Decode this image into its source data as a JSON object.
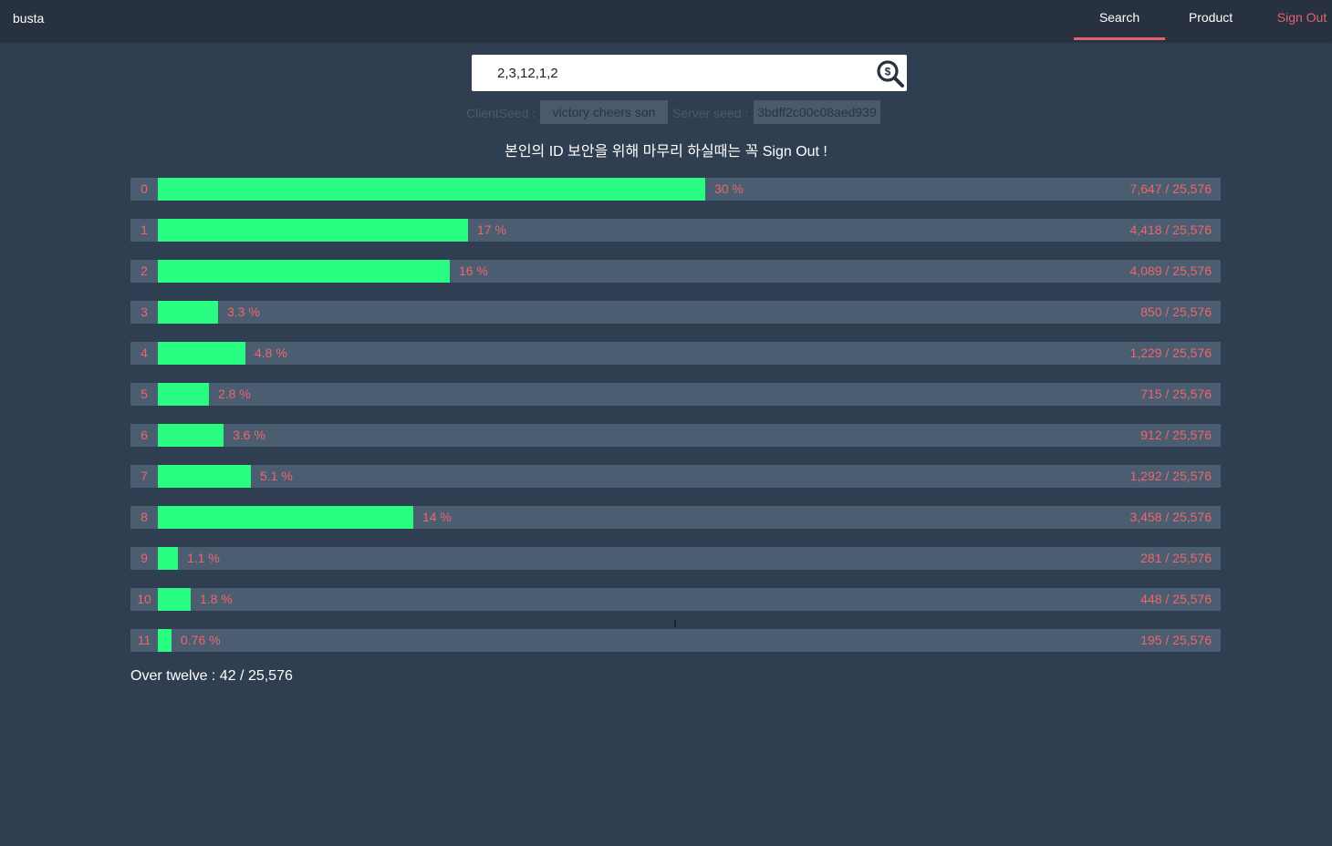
{
  "nav": {
    "brand": "busta",
    "search": "Search",
    "product": "Product",
    "signout": "Sign Out",
    "accent_color": "#e2636f"
  },
  "search": {
    "value": "2,3,12,1,2",
    "icon": "dollar-magnifier-icon"
  },
  "seeds": {
    "client_label": "ClientSeed :",
    "client_value": "victory cheers son",
    "server_label": "Server seed :",
    "server_value": "3bdff2c00c08aed939"
  },
  "notice": "본인의 ID 보안을 위해 마무리 하실때는 꼭 Sign Out !",
  "results": {
    "bar_color": "#28fd82",
    "text_color": "#f0646a",
    "rows": [
      {
        "index": "0",
        "fraction": 0.3,
        "percent": "30 %",
        "count": "7,647 / 25,576"
      },
      {
        "index": "1",
        "fraction": 0.17,
        "percent": "17 %",
        "count": "4,418 / 25,576"
      },
      {
        "index": "2",
        "fraction": 0.16,
        "percent": "16 %",
        "count": "4,089 / 25,576"
      },
      {
        "index": "3",
        "fraction": 0.033,
        "percent": "3.3 %",
        "count": "850 / 25,576"
      },
      {
        "index": "4",
        "fraction": 0.048,
        "percent": "4.8 %",
        "count": "1,229 / 25,576"
      },
      {
        "index": "5",
        "fraction": 0.028,
        "percent": "2.8 %",
        "count": "715 / 25,576"
      },
      {
        "index": "6",
        "fraction": 0.036,
        "percent": "3.6 %",
        "count": "912 / 25,576"
      },
      {
        "index": "7",
        "fraction": 0.051,
        "percent": "5.1 %",
        "count": "1,292 / 25,576"
      },
      {
        "index": "8",
        "fraction": 0.14,
        "percent": "14 %",
        "count": "3,458 / 25,576"
      },
      {
        "index": "9",
        "fraction": 0.011,
        "percent": "1.1 %",
        "count": "281 / 25,576"
      },
      {
        "index": "10",
        "fraction": 0.018,
        "percent": "1.8 %",
        "count": "448 / 25,576"
      },
      {
        "index": "11",
        "fraction": 0.0076,
        "percent": "0.76 %",
        "count": "195 / 25,576"
      }
    ]
  },
  "over_twelve": "Over twelve : 42 / 25,576"
}
